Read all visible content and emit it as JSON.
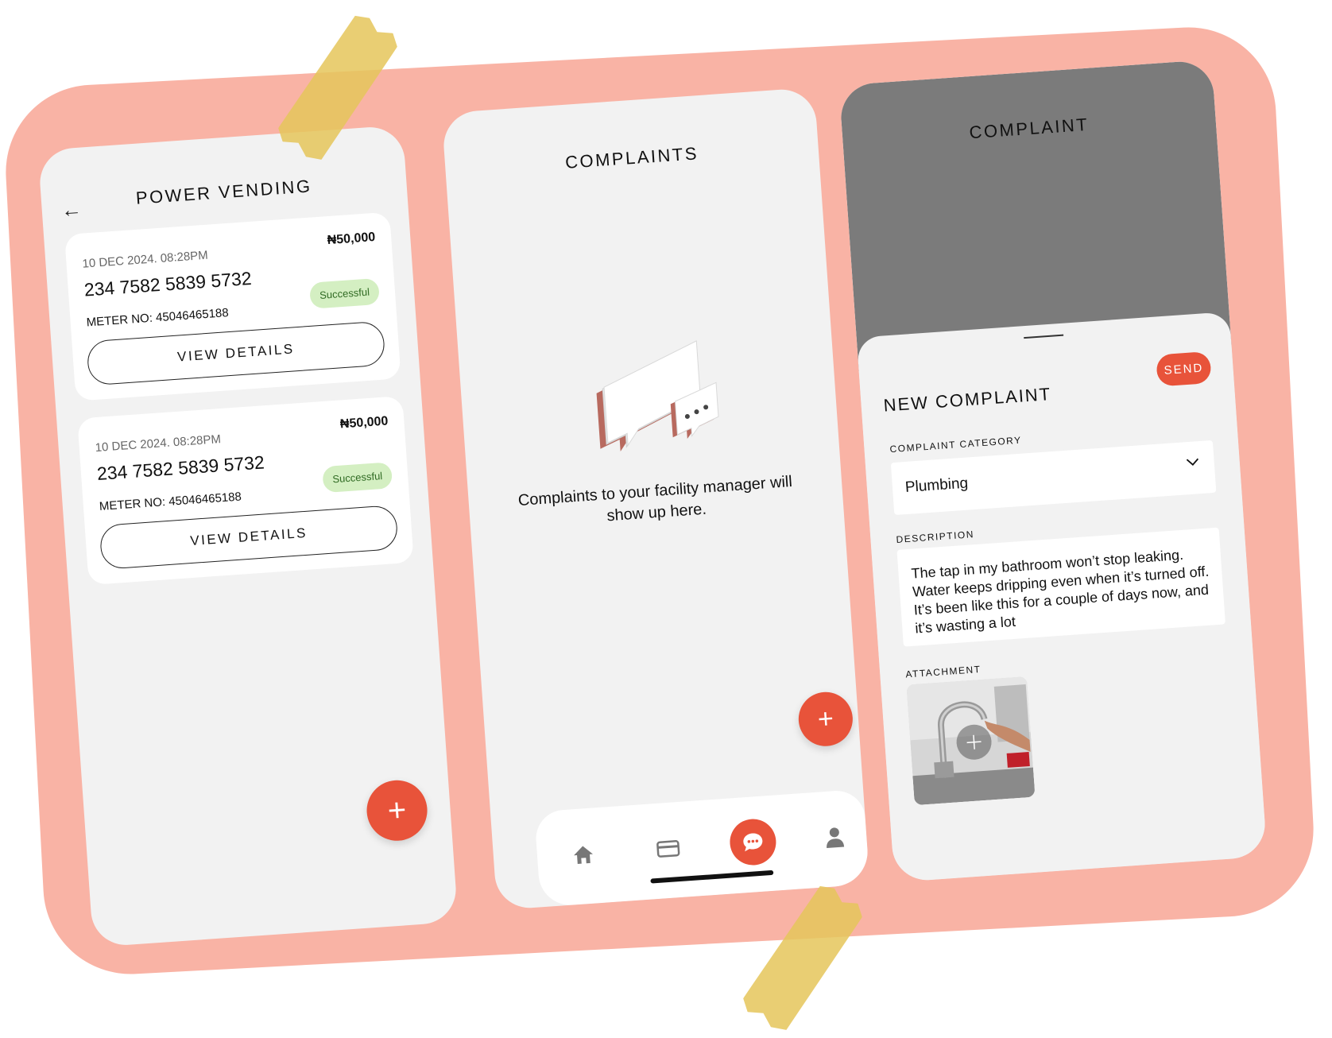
{
  "power_vending": {
    "title": "POWER VENDING",
    "back_label": "←",
    "transactions": [
      {
        "date": "10 DEC 2024. 08:28PM",
        "amount": "₦50,000",
        "number": "234 7582 5839 5732",
        "meter": "METER NO: 45046465188",
        "status": "Successful",
        "button": "VIEW DETAILS"
      },
      {
        "date": "10 DEC 2024. 08:28PM",
        "amount": "₦50,000",
        "number": "234 7582 5839 5732",
        "meter": "METER NO: 45046465188",
        "status": "Successful",
        "button": "VIEW DETAILS"
      }
    ],
    "fab_label": "+"
  },
  "complaints": {
    "title": "COMPLAINTS",
    "empty_text": "Complaints to your facility manager will show up here.",
    "fab_label": "+",
    "nav": [
      {
        "icon": "home-icon"
      },
      {
        "icon": "card-icon"
      },
      {
        "icon": "chat-icon",
        "active": true
      },
      {
        "icon": "person-icon"
      }
    ]
  },
  "complaint": {
    "title": "COMPLAINT",
    "sheet_title": "NEW COMPLAINT",
    "send_label": "SEND",
    "category_label": "COMPLAINT CATEGORY",
    "category_value": "Plumbing",
    "description_label": "DESCRIPTION",
    "description_value": "The tap in my bathroom won’t stop leaking. Water keeps dripping even when it’s turned off. It’s been like this for a couple of days now, and it’s wasting a lot",
    "attachment_label": "ATTACHMENT"
  },
  "colors": {
    "accent": "#e8533a",
    "board": "#f9b3a5",
    "success_bg": "#d4efc2"
  }
}
